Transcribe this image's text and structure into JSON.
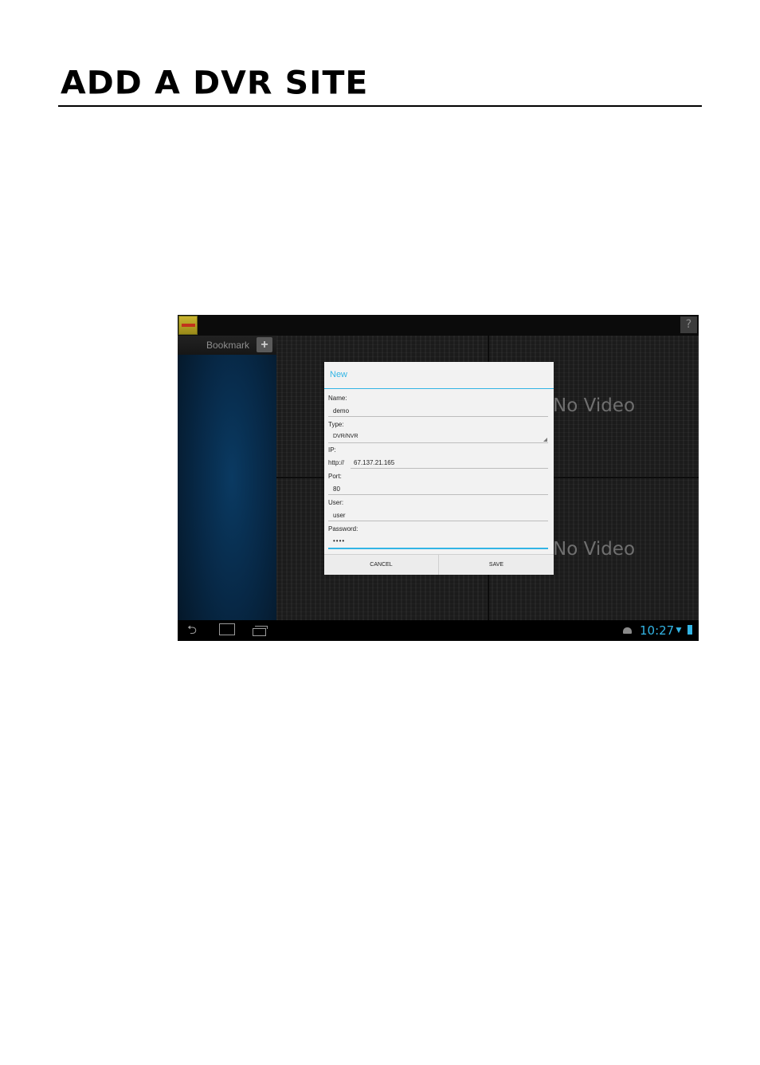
{
  "document": {
    "heading": "ADD A DVR SITE"
  },
  "app": {
    "sidebar": {
      "bookmark_label": "Bookmark",
      "add_icon": "plus-icon"
    },
    "help_icon": "question-icon",
    "video_tiles": [
      "No Video",
      "No Video"
    ]
  },
  "dialog": {
    "title": "New",
    "fields": {
      "name_label": "Name:",
      "name_value": "demo",
      "type_label": "Type:",
      "type_value": "DVR/NVR",
      "ip_label": "IP:",
      "ip_prefix": "http://",
      "ip_value": "67.137.21.165",
      "port_label": "Port:",
      "port_value": "80",
      "user_label": "User:",
      "user_value": "user",
      "password_label": "Password:",
      "password_value": "••••"
    },
    "buttons": {
      "cancel": "CANCEL",
      "save": "SAVE"
    },
    "accent_color": "#33b5e5"
  },
  "statusbar": {
    "time": "10:27",
    "icons": [
      "back-icon",
      "home-icon",
      "recent-apps-icon",
      "android-icon",
      "wifi-icon",
      "battery-icon"
    ]
  }
}
